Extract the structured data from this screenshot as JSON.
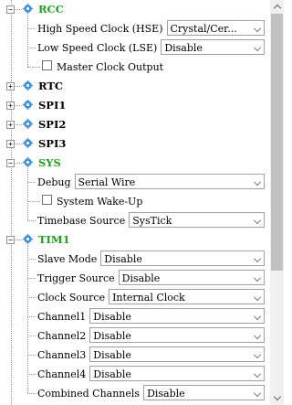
{
  "tree": [
    {
      "kind": "node",
      "label": "RCC",
      "green": true,
      "expanded": true,
      "icon": "gear-icon"
    },
    {
      "kind": "combo",
      "label": "High Speed Clock (HSE)",
      "value": "Crystal/Cer...",
      "indent": 1
    },
    {
      "kind": "combo",
      "label": "Low Speed Clock (LSE)",
      "value": "Disable",
      "indent": 1
    },
    {
      "kind": "check",
      "label": "Master Clock Output",
      "checked": false,
      "indent": 1
    },
    {
      "kind": "node",
      "label": "RTC",
      "green": false,
      "expanded": false,
      "icon": "gear-icon"
    },
    {
      "kind": "node",
      "label": "SPI1",
      "green": false,
      "expanded": false,
      "icon": "gear-icon"
    },
    {
      "kind": "node",
      "label": "SPI2",
      "green": false,
      "expanded": false,
      "icon": "gear-icon"
    },
    {
      "kind": "node",
      "label": "SPI3",
      "green": false,
      "expanded": false,
      "icon": "gear-icon"
    },
    {
      "kind": "node",
      "label": "SYS",
      "green": true,
      "expanded": true,
      "icon": "gear-icon"
    },
    {
      "kind": "combo",
      "label": "Debug",
      "value": "Serial Wire",
      "indent": 1
    },
    {
      "kind": "check",
      "label": "System Wake-Up",
      "checked": false,
      "indent": 1
    },
    {
      "kind": "combo",
      "label": "Timebase Source",
      "value": "SysTick",
      "indent": 1
    },
    {
      "kind": "node",
      "label": "TIM1",
      "green": true,
      "expanded": true,
      "icon": "gear-icon"
    },
    {
      "kind": "combo",
      "label": "Slave Mode",
      "value": "Disable",
      "indent": 1
    },
    {
      "kind": "combo",
      "label": "Trigger Source",
      "value": "Disable",
      "indent": 1
    },
    {
      "kind": "combo",
      "label": "Clock Source",
      "value": "Internal Clock",
      "indent": 1
    },
    {
      "kind": "combo",
      "label": "Channel1",
      "value": "Disable",
      "indent": 1
    },
    {
      "kind": "combo",
      "label": "Channel2",
      "value": "Disable",
      "indent": 1
    },
    {
      "kind": "combo",
      "label": "Channel3",
      "value": "Disable",
      "indent": 1
    },
    {
      "kind": "combo",
      "label": "Channel4",
      "value": "Disable",
      "indent": 1
    },
    {
      "kind": "combo",
      "label": "Combined Channels",
      "value": "Disable",
      "indent": 1
    }
  ],
  "colors": {
    "green_label": "#1ba31b",
    "gear_blue": "#3c8ee0"
  },
  "scrollbar": {
    "position_fraction": 0.0,
    "visible_fraction": 0.68
  }
}
